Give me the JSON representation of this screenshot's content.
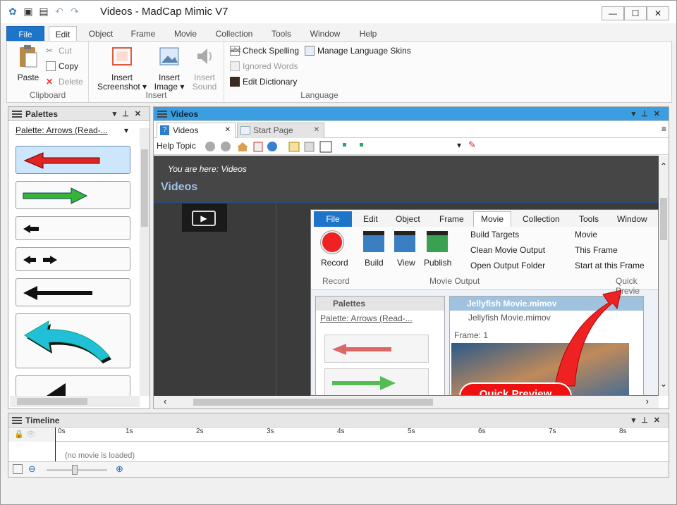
{
  "window": {
    "title": "Videos - MadCap Mimic V7",
    "controls": [
      "—",
      "☐",
      "✕"
    ]
  },
  "ribbon": {
    "tabs": [
      {
        "label": "File",
        "kind": "file"
      },
      {
        "label": "Edit",
        "kind": "active"
      },
      {
        "label": "Object"
      },
      {
        "label": "Frame"
      },
      {
        "label": "Movie"
      },
      {
        "label": "Collection"
      },
      {
        "label": "Tools"
      },
      {
        "label": "Window"
      },
      {
        "label": "Help"
      }
    ],
    "clipboard": {
      "label": "Clipboard",
      "paste": "Paste",
      "cut": "Cut",
      "copy": "Copy",
      "delete": "Delete"
    },
    "insert": {
      "label": "Insert",
      "screenshot": "Insert\nScreenshot ▾",
      "image": "Insert\nImage ▾",
      "sound": "Insert\nSound"
    },
    "language": {
      "label": "Language",
      "spell": "Check Spelling",
      "ignored": "Ignored Words",
      "dict": "Edit Dictionary",
      "skins": "Manage Language Skins"
    }
  },
  "palettes": {
    "title": "Palettes",
    "selector": "Palette: Arrows (Read-...",
    "selector_arrow": "▾"
  },
  "videos": {
    "title": "Videos",
    "tabs": [
      {
        "label": "Videos",
        "close": "✕"
      },
      {
        "label": "Start Page",
        "close": "✕"
      }
    ],
    "toolbar_label": "Help Topic",
    "breadcrumb": "You are here: Videos",
    "heading": "Videos",
    "embedded": {
      "tabs": [
        "File",
        "Edit",
        "Object",
        "Frame",
        "Movie",
        "Collection",
        "Tools",
        "Window"
      ],
      "record": "Record",
      "build": "Build",
      "view": "View",
      "publish": "Publish",
      "build_targets": "Build Targets",
      "clean_output": "Clean Movie Output",
      "open_output": "Open Output Folder",
      "movie": "Movie",
      "this_frame": "This Frame",
      "start_frame": "Start at this Frame",
      "group_record": "Record",
      "group_output": "Movie Output",
      "group_preview": "Quick Previe",
      "palettes_title": "Palettes",
      "palettes_selector": "Palette: Arrows (Read-...",
      "movie_panel_title": "Jellyfish Movie.mimov",
      "movie_tab": "Jellyfish Movie.mimov",
      "frame_label": "Frame:",
      "frame_value": "1",
      "callout": "Quick Preview"
    }
  },
  "timeline": {
    "title": "Timeline",
    "ticks": [
      "0s",
      "1s",
      "2s",
      "3s",
      "4s",
      "5s",
      "6s",
      "7s",
      "8s"
    ],
    "status": "(no movie is loaded)"
  }
}
